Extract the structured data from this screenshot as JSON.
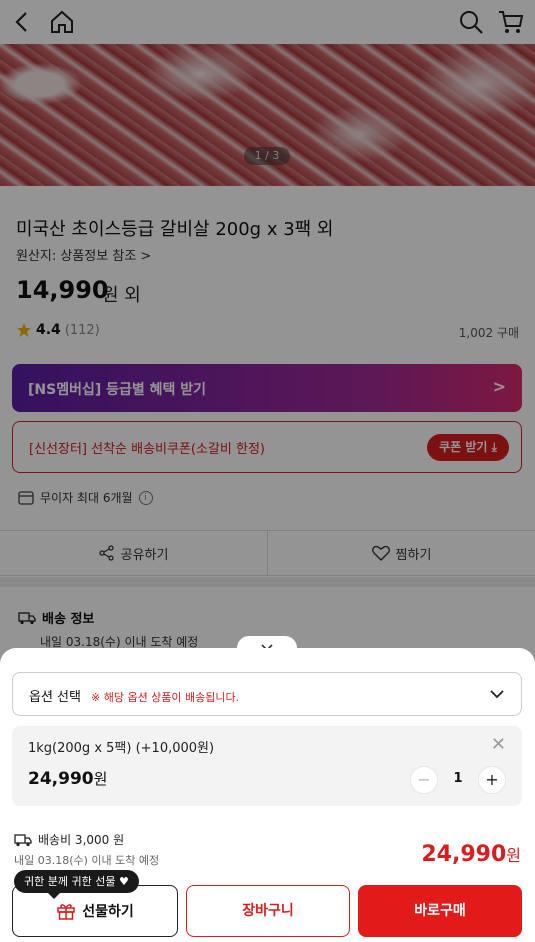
{
  "header": {
    "back_icon": "chevron-left-icon",
    "home_icon": "home-icon",
    "search_icon": "search-icon",
    "cart_icon": "cart-icon"
  },
  "hero": {
    "counter": "1 / 3"
  },
  "product": {
    "title": "미국산 초이스등급 갈비살 200g x 3팩 외",
    "origin": "원산지: 상품정보 참조 >",
    "price": "14,990",
    "price_suffix": "원 외",
    "rating": "4.4",
    "rating_count": "(112)",
    "purchases": "1,002 구매"
  },
  "membership": {
    "label": "[NS멤버십] 등급별 혜택 받기",
    "chevron": ">"
  },
  "coupon": {
    "label": "[신선장터] 선착순 배송비쿠폰(소갈비 한정)",
    "button": "쿠폰 받기 ⤓"
  },
  "interest_free": {
    "label": "무이자 최대 6개월",
    "info": "i"
  },
  "actions": {
    "share": "공유하기",
    "wish": "찜하기"
  },
  "delivery": {
    "heading": "배송 정보",
    "eta": "내일 03.18(수) 이내 도착 예정"
  },
  "sheet": {
    "option_label": "옵션 선택",
    "option_note": "※ 해당 옵션 상품이 배송됩니다.",
    "item_name": "1kg(200g x 5팩) (+10,000원)",
    "item_price": "24,990",
    "won": "원",
    "quantity": "1",
    "minus": "−",
    "plus": "+",
    "close": "✕",
    "shipping_fee": "배송비 3,000 원",
    "shipping_eta": "내일 03.18(수) 이내 도착 예정",
    "total": "24,990",
    "gift_tag": "귀한 분께 귀한 선물 ♥",
    "gift_button": "선물하기",
    "cart_button": "장바구니",
    "buy_button": "바로구매"
  },
  "colors": {
    "accent": "#e21a1a",
    "membership_start": "#5a1fa5",
    "membership_end": "#d82a6f"
  }
}
